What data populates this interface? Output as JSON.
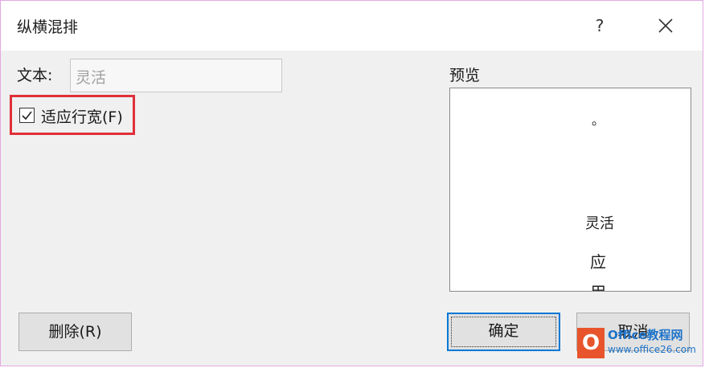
{
  "dialog": {
    "title": "纵横混排",
    "help_label": "?",
    "text_label": "文本:",
    "text_value": "灵活",
    "fit_checked": true,
    "fit_label": "适应行宽(F)",
    "preview_label": "预览",
    "preview": {
      "dot": "。",
      "row1": "灵活",
      "row2": "应",
      "row3": "用"
    },
    "buttons": {
      "delete": "删除(R)",
      "ok": "确定",
      "cancel": "取消"
    }
  },
  "watermark": {
    "logo": "O",
    "line1": "Office教程网",
    "line2": "www.office26.com"
  },
  "colors": {
    "highlight_border": "#e0303a",
    "focus_border": "#0078d7",
    "watermark_logo": "#e8552c",
    "watermark_text": "#1e73c9"
  }
}
